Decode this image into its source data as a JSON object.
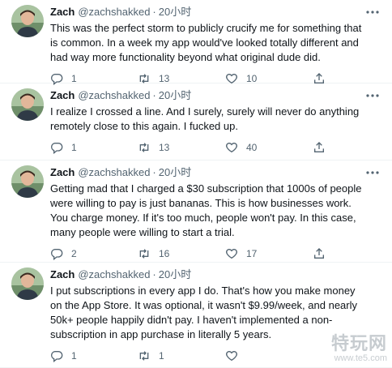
{
  "colors": {
    "text": "#0f1419",
    "secondary": "#536471",
    "divider": "#eff3f4"
  },
  "tweets": [
    {
      "name": "Zach",
      "handle": "@zachshakked",
      "separator": "·",
      "time": "20小时",
      "text": "This was the perfect storm to publicly crucify me for something that is common. In a week my app would've looked totally different and had way more functionality beyond what original dude did.",
      "replies": "1",
      "retweets": "13",
      "likes": "10"
    },
    {
      "name": "Zach",
      "handle": "@zachshakked",
      "separator": "·",
      "time": "20小时",
      "text": "I realize I crossed a line. And I surely, surely will never do anything remotely close to this again. I fucked up.",
      "replies": "1",
      "retweets": "13",
      "likes": "40"
    },
    {
      "name": "Zach",
      "handle": "@zachshakked",
      "separator": "·",
      "time": "20小时",
      "text": "Getting mad that I charged a $30 subscription that 1000s of people were willing to pay is just bananas. This is how businesses work. You charge money. If it's too much, people won't pay. In this case, many people were willing to start a trial.",
      "replies": "2",
      "retweets": "16",
      "likes": "17"
    },
    {
      "name": "Zach",
      "handle": "@zachshakked",
      "separator": "·",
      "time": "20小时",
      "text": "I put subscriptions in every app I do. That's how you make money on the App Store. It was optional, it wasn't $9.99/week, and nearly 50k+ people happily didn't pay. I haven't implemented a non-subscription in app purchase in literally 5 years.",
      "replies": "1",
      "retweets": "1",
      "likes": ""
    }
  ],
  "watermark": {
    "big": "特玩网",
    "small": "www.te5.com"
  },
  "icons": [
    "reply-icon",
    "retweet-icon",
    "like-icon",
    "share-icon",
    "more-icon"
  ]
}
